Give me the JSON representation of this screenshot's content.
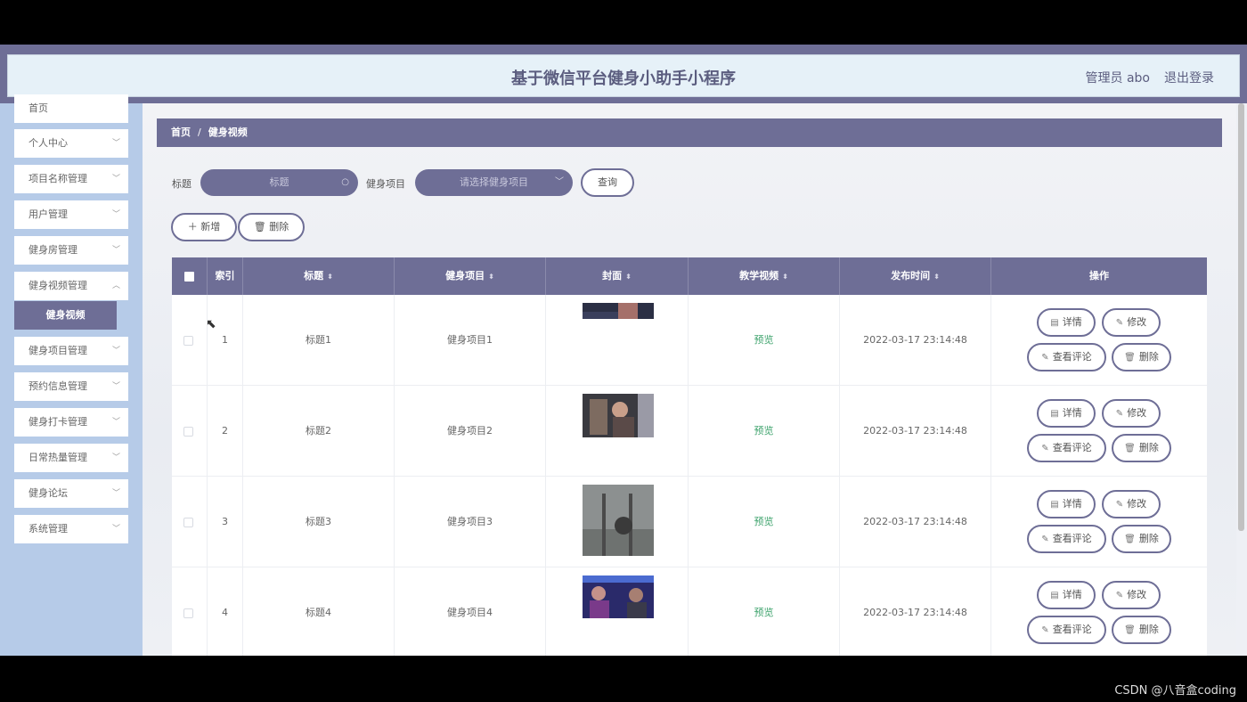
{
  "header": {
    "title": "基于微信平台健身小助手小程序",
    "user": "管理员 abo",
    "logout": "退出登录"
  },
  "sidebar": {
    "items": [
      "首页",
      "个人中心",
      "项目名称管理",
      "用户管理",
      "健身房管理",
      "健身视频管理",
      "健身项目管理",
      "预约信息管理",
      "健身打卡管理",
      "日常热量管理",
      "健身论坛",
      "系统管理"
    ],
    "active_sub": "健身视频"
  },
  "breadcrumb": {
    "home": "首页",
    "current": "健身视频"
  },
  "search": {
    "title_label": "标题",
    "title_placeholder": "标题",
    "project_label": "健身项目",
    "project_placeholder": "请选择健身项目",
    "query": "查询"
  },
  "toolbar": {
    "add": "新增",
    "delete": "删除"
  },
  "table": {
    "headers": [
      "索引",
      "标题",
      "健身项目",
      "封面",
      "教学视频",
      "发布时间",
      "操作"
    ],
    "rows": [
      {
        "index": "1",
        "title": "标题1",
        "project": "健身项目1",
        "video": "预览",
        "time": "2022-03-17 23:14:48"
      },
      {
        "index": "2",
        "title": "标题2",
        "project": "健身项目2",
        "video": "预览",
        "time": "2022-03-17 23:14:48"
      },
      {
        "index": "3",
        "title": "标题3",
        "project": "健身项目3",
        "video": "预览",
        "time": "2022-03-17 23:14:48"
      },
      {
        "index": "4",
        "title": "标题4",
        "project": "健身项目4",
        "video": "预览",
        "time": "2022-03-17 23:14:48"
      }
    ],
    "actions": {
      "detail": "详情",
      "edit": "修改",
      "comments": "查看评论",
      "delete": "删除"
    }
  },
  "watermark": "CSDN @八音盒coding"
}
